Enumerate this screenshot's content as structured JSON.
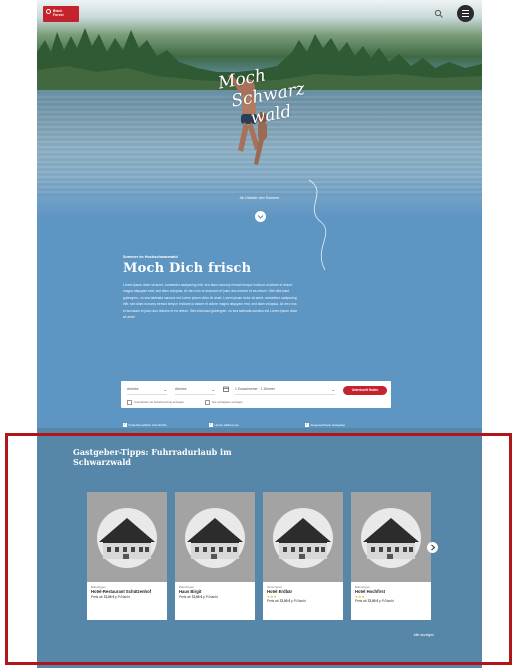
{
  "brand": {
    "logo_line1": "Black",
    "logo_line2": "Forest",
    "logo_color": "#c4222d"
  },
  "header": {
    "search_icon": "search-icon",
    "menu_icon": "hamburger-menu-icon"
  },
  "hero": {
    "script_line1": "Moch",
    "script_line2": "Schwarz",
    "script_line3": "wald",
    "link_text": "Ab Oktober den Sommer"
  },
  "intro": {
    "eyebrow": "Sommer im Hochschwarzwald",
    "title": "Moch Dich frisch",
    "paragraph": "Lorem ipsum dolor sit amet, consetetur sadipscing elitr, sed diam nonumy eirmod tempor invidunt ut labore et dolore magna aliquyam erat, sed diam voluptua. At vero eos et accusam et justo duo dolores et ea rebum. Stet clita kasd gubergren, no sea takimata sanctus est Lorem ipsum dolor sit amet. Lorem ipsum dolor sit amet, consetetur sadipscing elitr, sed diam nonumy eirmod tempor invidunt ut labore et dolore magna aliquyam erat, sed diam voluptua. At vero eos et accusam et justo duo dolores et ea rebum. Stet clita kasd gubergren, no sea takimata sanctus est Lorem ipsum dolor sit amet."
  },
  "search": {
    "field_arrival": "Anreise",
    "field_departure": "Abreise",
    "field_guests": "1 Erwachsener · 1 Zimmer",
    "submit_label": "Unterkunft finden",
    "option_1": "Unterkünfte mit Sofortbuchung anzeigen",
    "option_2": "Nur verfügbare anzeigen"
  },
  "filters": [
    "Kinderfreundliche Unterkünfte",
    "Hunde willkommen",
    "Ausgezeichnete Gastgeber"
  ],
  "hosts": {
    "title": "Gastgeber-Tipps: Fuhrradurlaub im Schwarzwald",
    "all_link": "Alle anzeigen",
    "cards": [
      {
        "location": "Bräunlingen",
        "name": "Hotel-Restaurant Schützenhof",
        "stars": "",
        "price_prefix": "Preis ab",
        "price": "72,00 €",
        "price_suffix": "p.P./Nacht"
      },
      {
        "location": "Bräunlingen",
        "name": "Haus Birgit",
        "stars": "",
        "price_prefix": "Preis ab",
        "price": "72,00 €",
        "price_suffix": "p.P./Nacht"
      },
      {
        "location": "Hinterzarten",
        "name": "Hotel Erdbär",
        "stars": "★★★",
        "price_prefix": "Preis ab",
        "price": "72,00 €",
        "price_suffix": "p.P./Nacht"
      },
      {
        "location": "Bräunlingen",
        "name": "Hotel Hochfirst",
        "stars": "★★★",
        "price_prefix": "Preis ab",
        "price": "72,00 €",
        "price_suffix": "p.P./Nacht"
      }
    ]
  },
  "colors": {
    "intro_blue": "#5d95c3",
    "hosts_blue": "#5687a9",
    "accent_red": "#c4222d",
    "highlight_red": "#b01519"
  }
}
